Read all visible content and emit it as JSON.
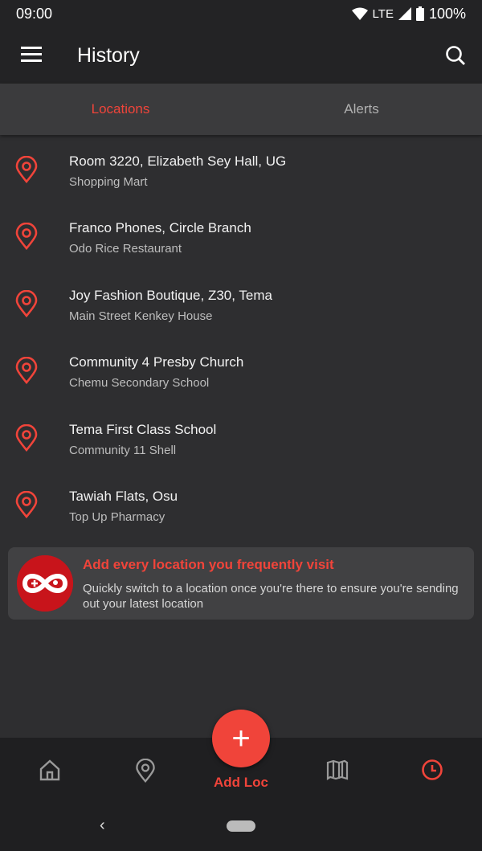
{
  "status": {
    "time": "09:00",
    "network": "LTE",
    "battery": "100%"
  },
  "header": {
    "title": "History"
  },
  "tabs": [
    {
      "label": "Locations",
      "active": true
    },
    {
      "label": "Alerts",
      "active": false
    }
  ],
  "locations": [
    {
      "title": "Room 3220, Elizabeth Sey Hall, UG",
      "subtitle": "Shopping Mart"
    },
    {
      "title": "Franco Phones, Circle Branch",
      "subtitle": "Odo Rice Restaurant"
    },
    {
      "title": "Joy Fashion Boutique, Z30, Tema",
      "subtitle": "Main Street Kenkey House"
    },
    {
      "title": "Community 4 Presby Church",
      "subtitle": "Chemu Secondary School"
    },
    {
      "title": "Tema First Class School",
      "subtitle": "Community 11 Shell"
    },
    {
      "title": "Tawiah Flats, Osu",
      "subtitle": "Top Up Pharmacy"
    }
  ],
  "promo": {
    "title": "Add every location you frequently visit",
    "text": "Quickly switch to a location once you're there to ensure you're sending out your latest location"
  },
  "bottom_nav": {
    "add_label": "Add Loc",
    "items": [
      "home-icon",
      "location-pin-icon",
      "map-icon",
      "clock-icon"
    ],
    "active": "clock-icon"
  },
  "colors": {
    "accent": "#f0443a",
    "background": "#2e2e30"
  }
}
